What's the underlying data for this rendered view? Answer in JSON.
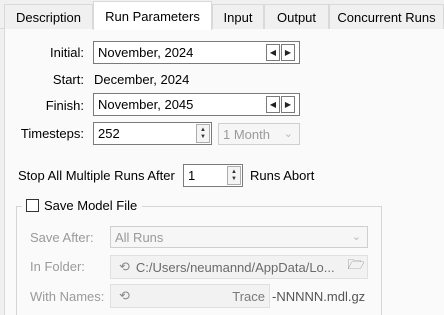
{
  "tabs": [
    {
      "label": "Description",
      "active": false
    },
    {
      "label": "Run Parameters",
      "active": true
    },
    {
      "label": "Input",
      "active": false
    },
    {
      "label": "Output",
      "active": false
    },
    {
      "label": "Concurrent Runs",
      "active": false
    }
  ],
  "initial": {
    "label": "Initial:",
    "value": "November, 2024"
  },
  "start": {
    "label": "Start:",
    "value": "December, 2024"
  },
  "finish": {
    "label": "Finish:",
    "value": "November, 2045"
  },
  "timesteps": {
    "label": "Timesteps:",
    "value": "252",
    "unit": "1 Month"
  },
  "stop_runs": {
    "prefix": "Stop All Multiple Runs After",
    "value": "1",
    "suffix": "Runs Abort"
  },
  "save_model": {
    "label": "Save Model File",
    "checked": false,
    "save_after": {
      "label": "Save After:",
      "value": "All Runs"
    },
    "in_folder": {
      "label": "In Folder:",
      "value": "C:/Users/neumannd/AppData/Lo..."
    },
    "with_names": {
      "label": "With Names:",
      "prefix": "Trace",
      "suffix": "-NNNNN.mdl.gz"
    }
  }
}
